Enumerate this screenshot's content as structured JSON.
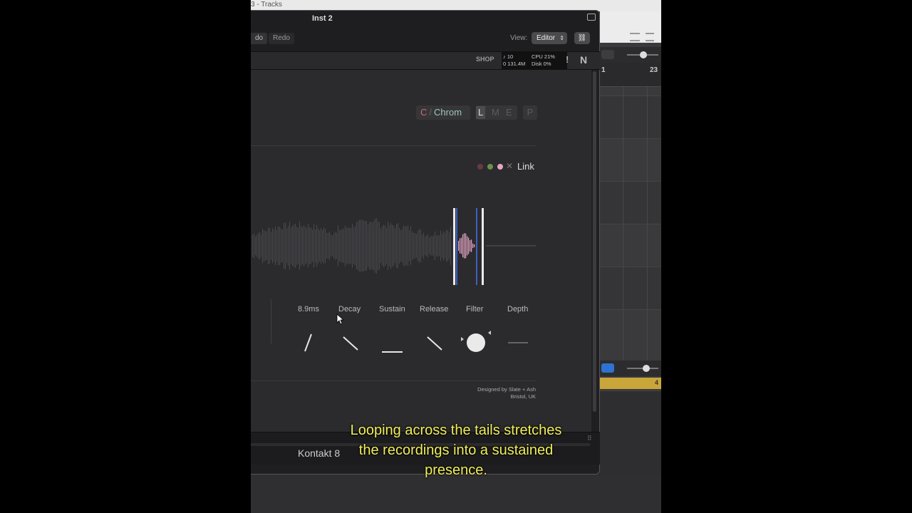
{
  "logic": {
    "window_title": "3 - Tracks",
    "ruler_numbers": [
      "1",
      "23"
    ],
    "region_number": "4"
  },
  "plugin": {
    "title": "Inst 2",
    "undo_label": "do",
    "redo_label": "Redo",
    "view_label": "View:",
    "view_value": "Editor",
    "shop_label": "SHOP",
    "stats": {
      "voices": "♪ 10",
      "memory": "0 131.4M",
      "cpu": "CPU 21%",
      "disk": "Disk 0%"
    },
    "warning": "!",
    "logo": "N",
    "footer_name": "Kontakt 8"
  },
  "instrument": {
    "scale_root": "C",
    "scale_separator": "/",
    "scale_name": "Chrom",
    "modes": [
      "L",
      "M",
      "E"
    ],
    "active_mode": "L",
    "p_label": "P",
    "link_label": "Link",
    "link_dot_colors": [
      "#6a3a45",
      "#6f8f4a",
      "#e7a6c5"
    ],
    "envelope": {
      "labels": [
        "8.9ms",
        "Decay",
        "Sustain",
        "Release",
        "Filter",
        "Depth"
      ]
    },
    "credit_line1": "Designed by Slate + Ash",
    "credit_line2": "Bristol, UK"
  },
  "caption": {
    "line1": "Looping across the tails stretches",
    "line2": "the recordings into a sustained",
    "line3": "presence."
  }
}
